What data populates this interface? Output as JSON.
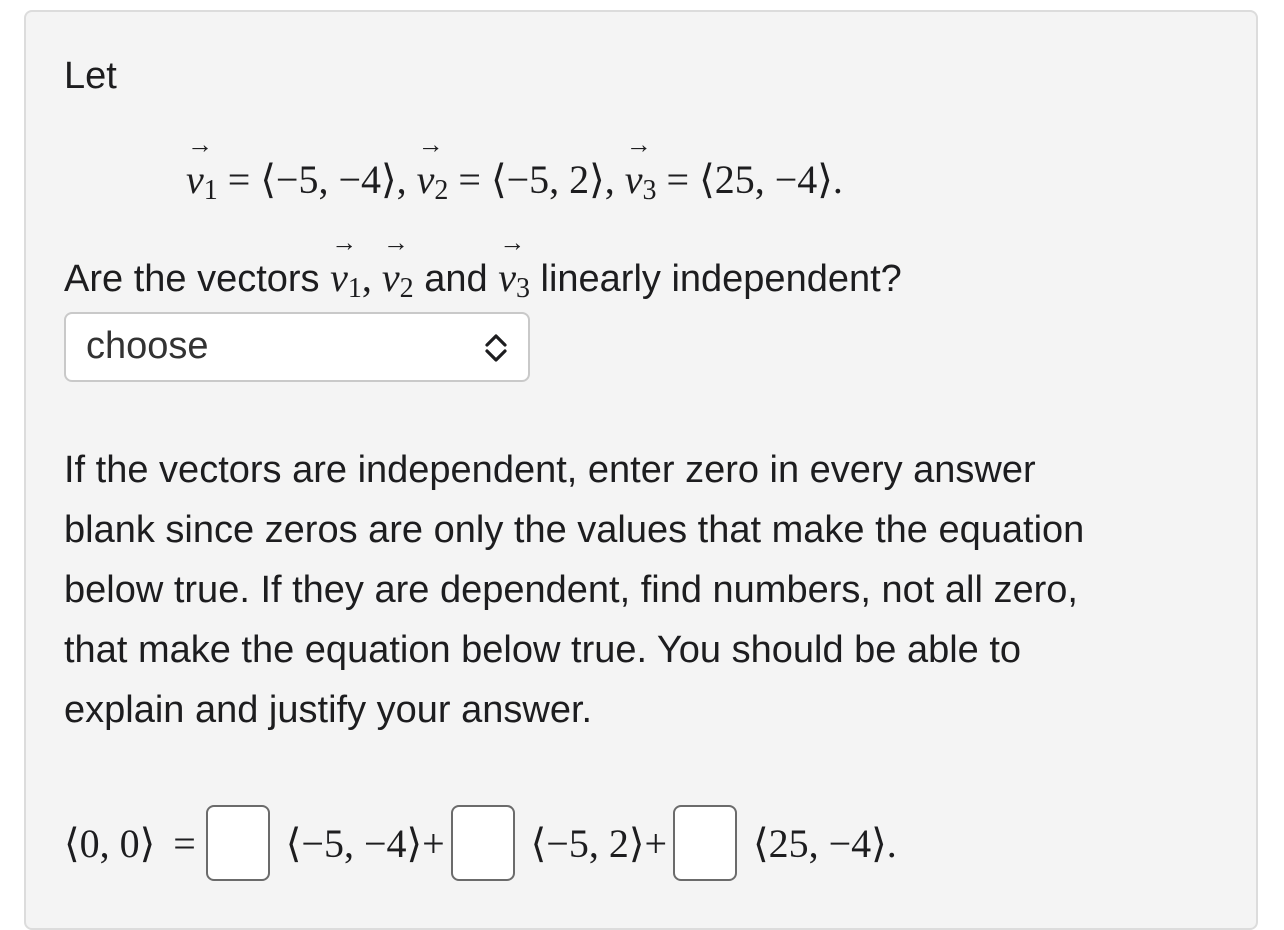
{
  "intro": {
    "let_text": "Let"
  },
  "definition": {
    "v1_sub": "1",
    "v1_value": "⟨−5, −4⟩",
    "v2_sub": "2",
    "v2_value": "⟨−5, 2⟩",
    "v3_sub": "3",
    "v3_value": "⟨25, −4⟩"
  },
  "question": {
    "prefix": "Are the vectors",
    "v1_sub": "1",
    "v2_sub": "2",
    "v3_sub": "3",
    "and": "and",
    "suffix": "linearly independent?"
  },
  "select": {
    "selected": "choose"
  },
  "instructions": {
    "lines": [
      "If the vectors are independent, enter zero in every answer",
      "blank since zeros are only the values that make the equation",
      "below true. If they are dependent, find numbers, not all zero,",
      "that make the equation below true. You should be able to",
      "explain and justify your answer."
    ]
  },
  "equation": {
    "lhs": "⟨0, 0⟩",
    "equals": "=",
    "vec1": "⟨−5, −4⟩",
    "plus1": "+",
    "vec2": "⟨−5, 2⟩",
    "plus2": "+",
    "vec3": "⟨25, −4⟩",
    "period": ".",
    "blanks": [
      "",
      "",
      ""
    ]
  },
  "colors": {
    "card_bg": "#f4f4f4",
    "card_border": "#dcdcdc",
    "text": "#1d1d1f",
    "input_border": "#6b6b6b"
  }
}
